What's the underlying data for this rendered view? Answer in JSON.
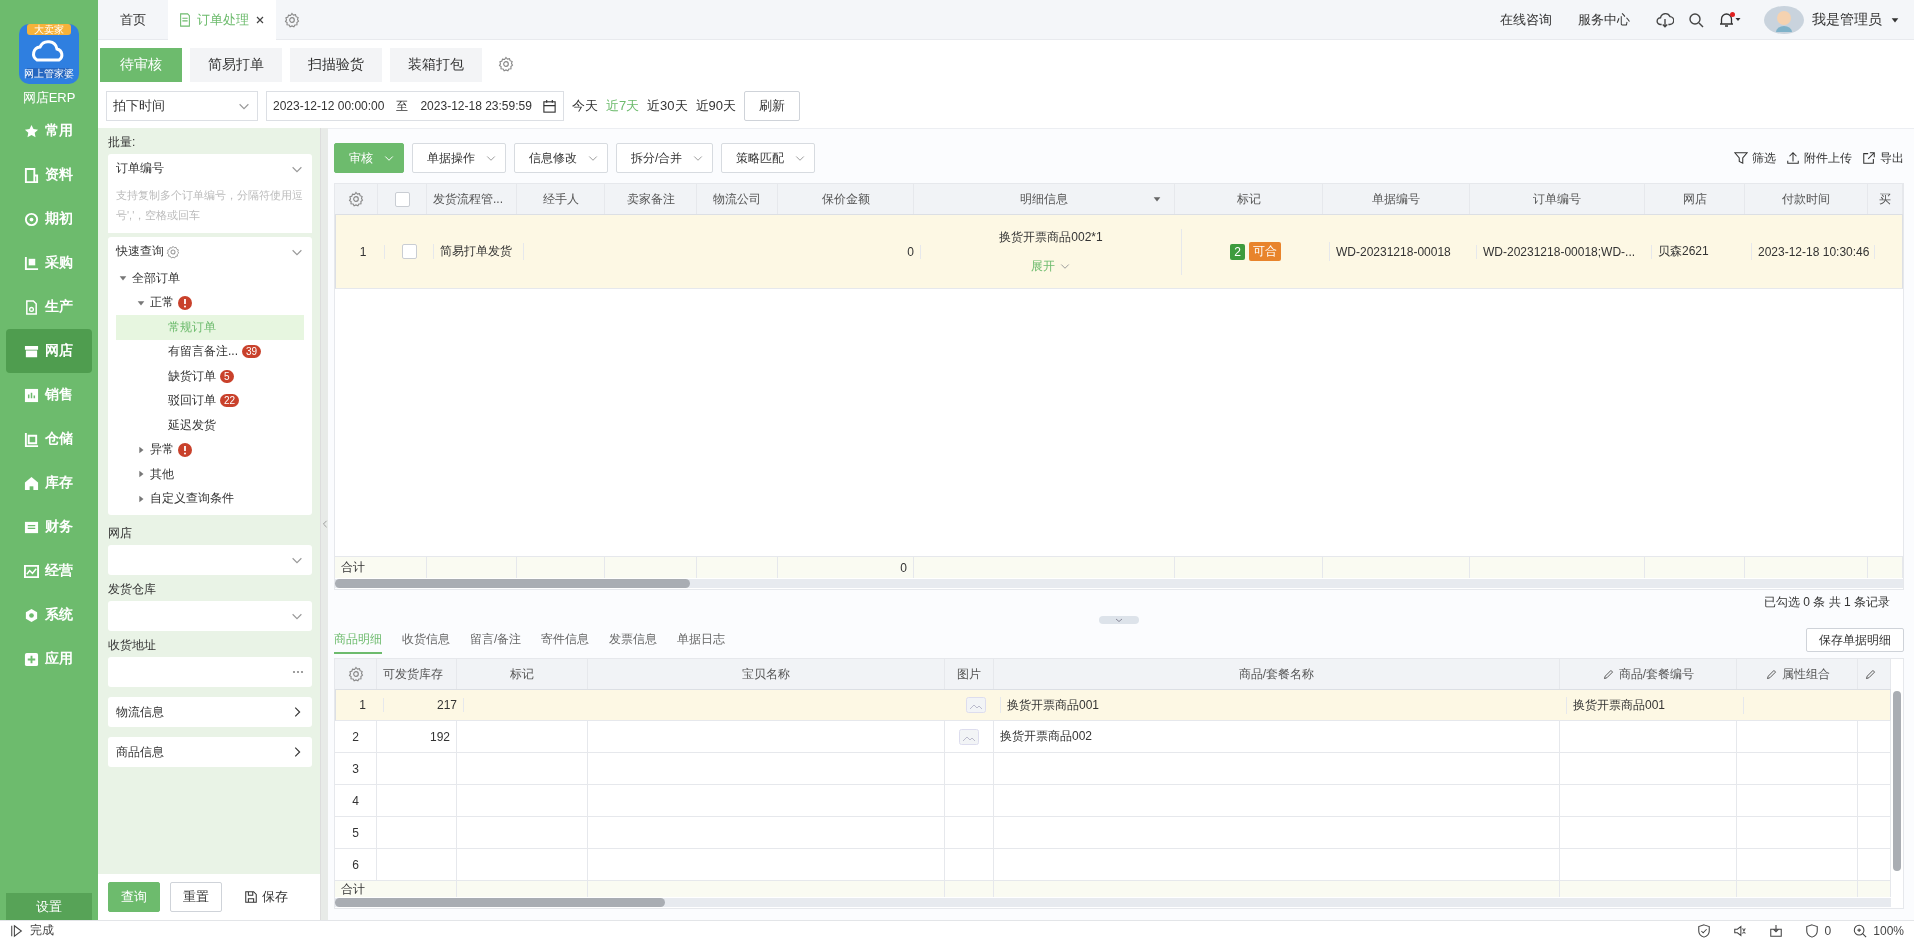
{
  "app": {
    "logo_top": "大卖家",
    "logo_bottom": "网上管家婆",
    "name": "网店ERP"
  },
  "nav": [
    {
      "label": "常用",
      "selected": false
    },
    {
      "label": "资料",
      "selected": false
    },
    {
      "label": "期初",
      "selected": false
    },
    {
      "label": "采购",
      "selected": false
    },
    {
      "label": "生产",
      "selected": false
    },
    {
      "label": "网店",
      "selected": true
    },
    {
      "label": "销售",
      "selected": false
    },
    {
      "label": "仓储",
      "selected": false
    },
    {
      "label": "库存",
      "selected": false
    },
    {
      "label": "财务",
      "selected": false
    },
    {
      "label": "经营",
      "selected": false
    },
    {
      "label": "系统",
      "selected": false
    },
    {
      "label": "应用",
      "selected": false
    }
  ],
  "settings": "设置",
  "top_tabs": [
    {
      "label": "首页",
      "selected": false,
      "closable": false
    },
    {
      "label": "订单处理",
      "selected": true,
      "closable": true
    }
  ],
  "header_links": [
    "在线咨询",
    "服务中心"
  ],
  "notification": {
    "unread": true
  },
  "user": {
    "name": "我是管理员"
  },
  "sub_tabs": [
    {
      "label": "待审核",
      "selected": true
    },
    {
      "label": "简易打单",
      "selected": false
    },
    {
      "label": "扫描验货",
      "selected": false
    },
    {
      "label": "装箱打包",
      "selected": false
    }
  ],
  "filter_bar": {
    "time_field": "拍下时间",
    "start": "2023-12-12 00:00:00",
    "separator": "至",
    "end": "2023-12-18 23:59:59",
    "ranges": [
      {
        "label": "今天",
        "selected": false
      },
      {
        "label": "近7天",
        "selected": true
      },
      {
        "label": "近30天",
        "selected": false
      },
      {
        "label": "近90天",
        "selected": false
      }
    ],
    "refresh": "刷新"
  },
  "query_panel": {
    "batch_label": "批量:",
    "batch_field": "订单编号",
    "batch_placeholder": "支持复制多个订单编号，分隔符使用逗号','，空格或回车",
    "quick_title": "快速查询",
    "tree": [
      {
        "label": "全部订单",
        "expanded": true,
        "alert": false,
        "selected": false,
        "children": [
          {
            "label": "正常",
            "expanded": true,
            "alert": true,
            "selected": false,
            "children": [
              {
                "label": "常规订单",
                "alert": false,
                "selected": true
              },
              {
                "label": "有留言备注...",
                "alert": false,
                "selected": false,
                "badge": "39"
              },
              {
                "label": "缺货订单",
                "alert": false,
                "selected": false,
                "badge": "5"
              },
              {
                "label": "驳回订单",
                "alert": false,
                "selected": false,
                "badge": "22"
              },
              {
                "label": "延迟发货",
                "alert": false,
                "selected": false
              }
            ]
          },
          {
            "label": "异常",
            "expanded": false,
            "alert": true,
            "selected": false
          },
          {
            "label": "其他",
            "expanded": false,
            "alert": false,
            "selected": false
          },
          {
            "label": "自定义查询条件",
            "expanded": false,
            "alert": false,
            "selected": false
          }
        ]
      }
    ],
    "fields": [
      {
        "kind": "select",
        "label": "网店"
      },
      {
        "kind": "select",
        "label": "发货仓库"
      },
      {
        "kind": "text",
        "label": "收货地址"
      },
      {
        "kind": "link",
        "label": "物流信息"
      },
      {
        "kind": "link",
        "label": "商品信息"
      }
    ],
    "buttons": {
      "query": "查询",
      "reset": "重置",
      "save": "保存"
    }
  },
  "toolbar": {
    "actions": [
      {
        "label": "审核",
        "kind": "primary"
      },
      {
        "label": "单据操作",
        "kind": "dropdown"
      },
      {
        "label": "信息修改",
        "kind": "dropdown"
      },
      {
        "label": "拆分/合并",
        "kind": "dropdown"
      },
      {
        "label": "策略匹配",
        "kind": "dropdown"
      }
    ],
    "tools": [
      "筛选",
      "附件上传",
      "导出"
    ]
  },
  "orders": {
    "all_checked": false,
    "columns": [
      {
        "label": "发货流程管...",
        "dropdown": false
      },
      {
        "label": "经手人",
        "dropdown": false
      },
      {
        "label": "卖家备注",
        "dropdown": false
      },
      {
        "label": "物流公司",
        "dropdown": false
      },
      {
        "label": "保价金额",
        "dropdown": false
      },
      {
        "label": "明细信息",
        "dropdown": true
      },
      {
        "label": "标记",
        "dropdown": false
      },
      {
        "label": "单据编号",
        "dropdown": false
      },
      {
        "label": "订单编号",
        "dropdown": false
      },
      {
        "label": "网店",
        "dropdown": false
      },
      {
        "label": "付款时间",
        "dropdown": false
      },
      {
        "label": "买",
        "dropdown": false
      }
    ],
    "rows": [
      {
        "index": "1",
        "checked": false,
        "selected": true,
        "flow": "简易打单发货",
        "insured_amount": "0",
        "detail": {
          "item": "换货开票商品002*1",
          "expand": "展开"
        },
        "marks": [
          {
            "label": "2",
            "color": "#3d9b3d"
          },
          {
            "label": "可合",
            "color": "#e8842c"
          }
        ],
        "doc_no": "WD-20231218-00018",
        "order_no": "WD-20231218-00018;WD-...",
        "shop": "贝森2621",
        "paid_at": "2023-12-18 10:30:46"
      }
    ],
    "totals": {
      "label": "合计",
      "amount": "0"
    },
    "summary": "已勾选 0 条 共 1 条记录"
  },
  "detail": {
    "tabs": [
      {
        "label": "商品明细",
        "selected": true
      },
      {
        "label": "收货信息",
        "selected": false
      },
      {
        "label": "留言/备注",
        "selected": false
      },
      {
        "label": "寄件信息",
        "selected": false
      },
      {
        "label": "发票信息",
        "selected": false
      },
      {
        "label": "单据日志",
        "selected": false
      }
    ],
    "save": "保存单据明细",
    "columns": [
      {
        "label": "可发货库存",
        "editable": false
      },
      {
        "label": "标记",
        "editable": false
      },
      {
        "label": "宝贝名称",
        "editable": false
      },
      {
        "label": "图片",
        "editable": false
      },
      {
        "label": "商品/套餐名称",
        "editable": false
      },
      {
        "label": "商品/套餐编号",
        "editable": true
      },
      {
        "label": "属性组合",
        "editable": true
      },
      {
        "editable": true
      }
    ],
    "rows": [
      {
        "index": "1",
        "selected": true,
        "stock": "217",
        "has_image": true,
        "product_name": "换货开票商品001",
        "product_code": "换货开票商品001"
      },
      {
        "index": "2",
        "selected": false,
        "stock": "192",
        "has_image": true,
        "product_name": "换货开票商品002"
      },
      {
        "index": "3",
        "selected": false,
        "has_image": false
      },
      {
        "index": "4",
        "selected": false,
        "has_image": false
      },
      {
        "index": "5",
        "selected": false,
        "has_image": false
      },
      {
        "index": "6",
        "selected": false,
        "has_image": false
      }
    ],
    "total_label": "合计"
  },
  "status_bar": {
    "text": "完成",
    "notifications": "0",
    "zoom": "100%"
  }
}
